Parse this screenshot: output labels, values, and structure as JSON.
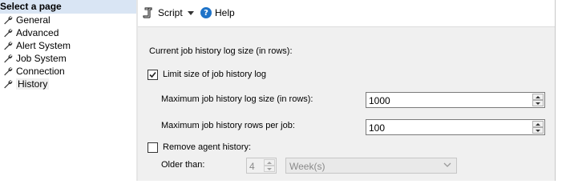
{
  "left": {
    "header": "Select a page",
    "items": [
      {
        "label": "General"
      },
      {
        "label": "Advanced"
      },
      {
        "label": "Alert System"
      },
      {
        "label": "Job System"
      },
      {
        "label": "Connection"
      },
      {
        "label": "History"
      }
    ],
    "selected": "History"
  },
  "toolbar": {
    "script_label": "Script",
    "help_label": "Help"
  },
  "history": {
    "section_label": "Current job history log size (in rows):",
    "limit_checkbox_label": "Limit size of job history log",
    "limit_checked": true,
    "max_log_label": "Maximum job history log size (in rows):",
    "max_log_value": "1000",
    "max_per_job_label": "Maximum job history rows per job:",
    "max_per_job_value": "100",
    "remove_checkbox_label": "Remove agent history:",
    "remove_checked": false,
    "older_than_label": "Older than:",
    "older_than_value": "4",
    "period_value": "Week(s)"
  },
  "colors": {
    "header_bg": "#d9e5f4",
    "panel_bg": "#f0f0f0",
    "help_icon": "#1e73c8"
  }
}
